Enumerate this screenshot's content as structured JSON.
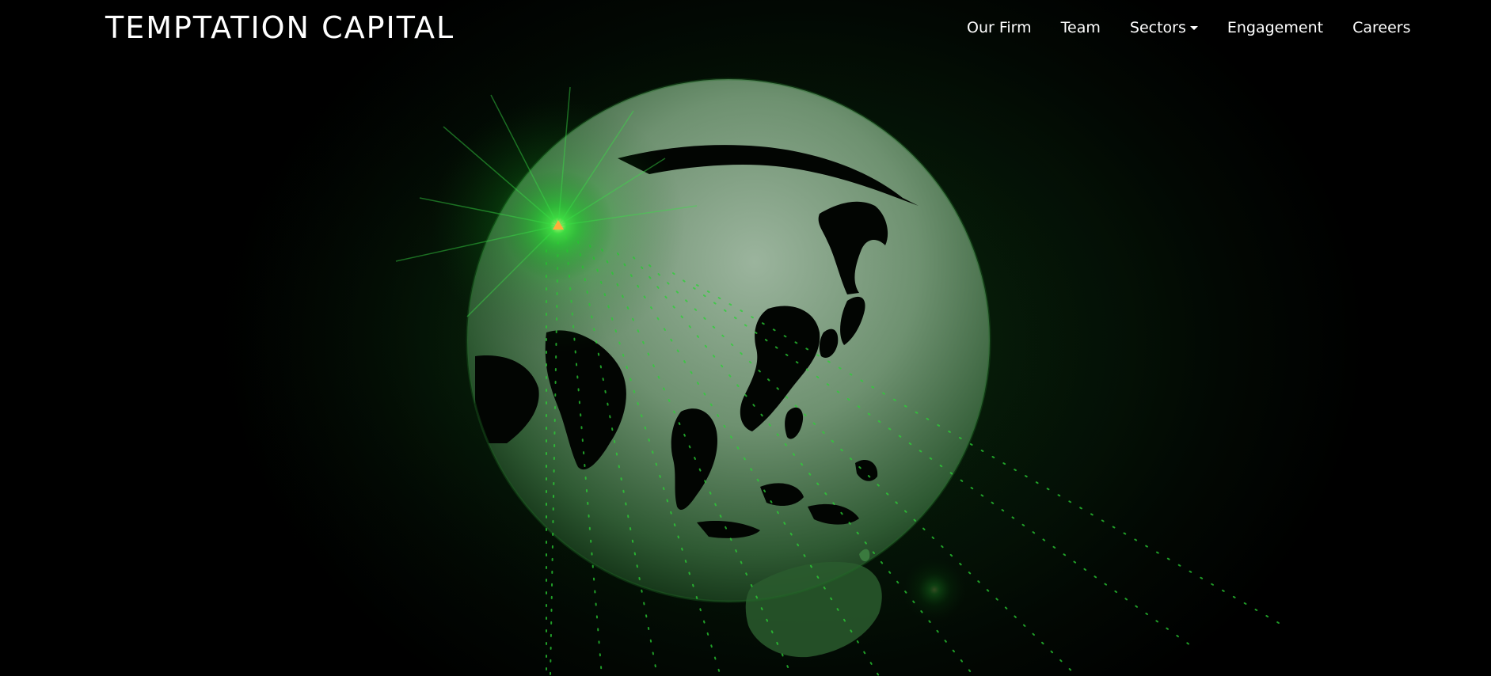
{
  "brand": {
    "name": "TEMPTATION CAPITAL"
  },
  "nav": {
    "items": [
      {
        "label": "Our Firm"
      },
      {
        "label": "Team"
      },
      {
        "label": "Sectors",
        "has_dropdown": true
      },
      {
        "label": "Engagement"
      },
      {
        "label": "Careers"
      }
    ]
  },
  "hero": {
    "image": "globe-asia-pacific-green-glow",
    "accent_color": "#1fc62a",
    "background_color": "#000000"
  }
}
